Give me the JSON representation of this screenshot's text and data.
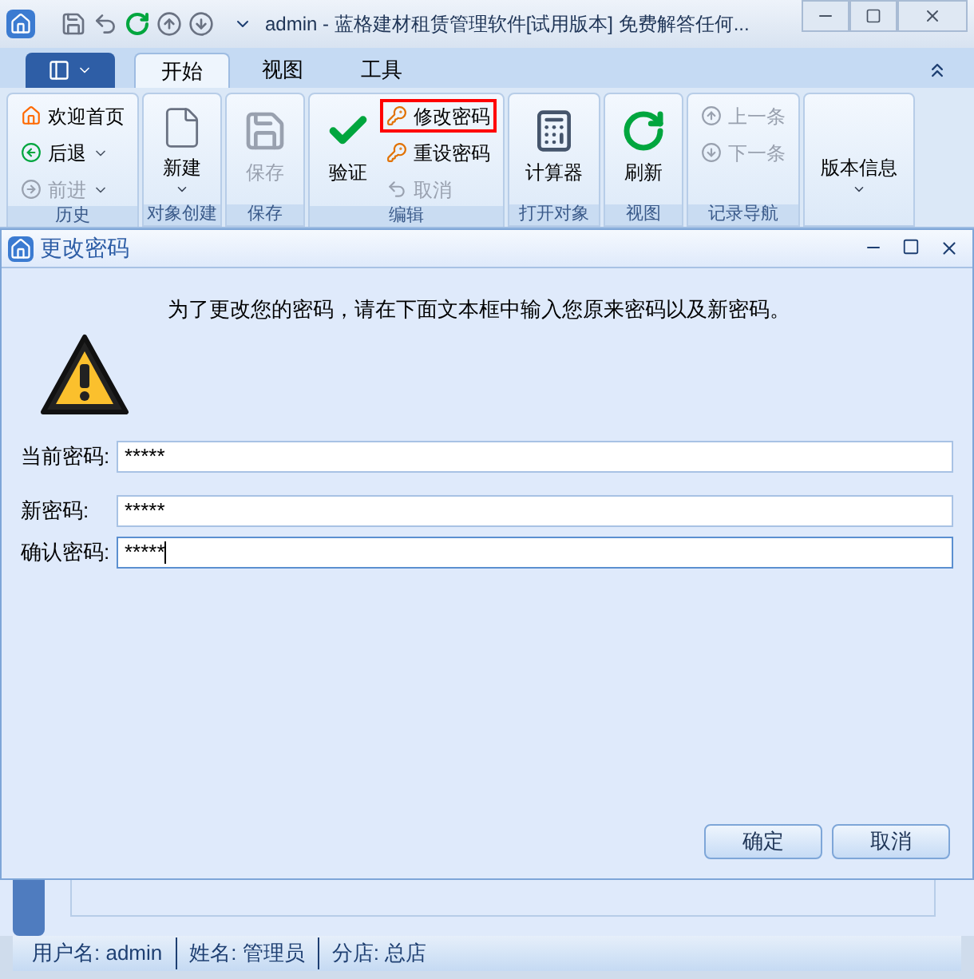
{
  "window": {
    "title": "admin - 蓝格建材租赁管理软件[试用版本] 免费解答任何..."
  },
  "tabs": [
    {
      "label": "开始",
      "selected": true
    },
    {
      "label": "视图",
      "selected": false
    },
    {
      "label": "工具",
      "selected": false
    }
  ],
  "ribbon_groups": [
    {
      "label": "历史",
      "items": [
        {
          "kind": "small",
          "label": "欢迎首页",
          "disabled": false,
          "dropdown": false,
          "highlighted": false
        },
        {
          "kind": "small",
          "label": "后退",
          "disabled": false,
          "dropdown": true,
          "highlighted": false
        },
        {
          "kind": "small",
          "label": "前进",
          "disabled": true,
          "dropdown": true,
          "highlighted": false
        }
      ]
    },
    {
      "label": "对象创建",
      "items": [
        {
          "kind": "large",
          "label": "新建",
          "disabled": false,
          "dropdown": true,
          "highlighted": false
        }
      ]
    },
    {
      "label": "保存",
      "items": [
        {
          "kind": "large",
          "label": "保存",
          "disabled": true,
          "dropdown": false,
          "highlighted": false
        }
      ]
    },
    {
      "label": "编辑",
      "items": [
        {
          "kind": "large",
          "label": "验证",
          "disabled": false,
          "dropdown": false,
          "highlighted": false
        },
        {
          "kind": "small",
          "label": "修改密码",
          "disabled": false,
          "dropdown": false,
          "highlighted": true
        },
        {
          "kind": "small",
          "label": "重设密码",
          "disabled": false,
          "dropdown": false,
          "highlighted": false
        },
        {
          "kind": "small",
          "label": "取消",
          "disabled": true,
          "dropdown": false,
          "highlighted": false
        }
      ]
    },
    {
      "label": "打开对象",
      "items": [
        {
          "kind": "large",
          "label": "计算器",
          "disabled": false,
          "dropdown": false,
          "highlighted": false
        }
      ]
    },
    {
      "label": "视图",
      "items": [
        {
          "kind": "large",
          "label": "刷新",
          "disabled": false,
          "dropdown": false,
          "highlighted": false
        }
      ]
    },
    {
      "label": "记录导航",
      "items": [
        {
          "kind": "small",
          "label": "上一条",
          "disabled": true,
          "dropdown": false,
          "highlighted": false
        },
        {
          "kind": "small",
          "label": "下一条",
          "disabled": true,
          "dropdown": false,
          "highlighted": false
        }
      ]
    },
    {
      "items": [
        {
          "kind": "large",
          "label": "版本信息",
          "disabled": false,
          "dropdown": true,
          "highlighted": false
        }
      ]
    }
  ],
  "dialog": {
    "title": "更改密码",
    "message": "为了更改您的密码，请在下面文本框中输入您原来密码以及新密码。",
    "fields": [
      {
        "label": "当前密码:",
        "value": "*****",
        "focused": false
      },
      {
        "label": "新密码:",
        "value": "*****",
        "focused": false
      },
      {
        "label": "确认密码:",
        "value": "*****",
        "focused": true
      }
    ],
    "buttons": [
      "确定",
      "取消"
    ]
  },
  "status_bar": [
    "用户名: admin",
    "姓名: 管理员",
    "分店: 总店"
  ]
}
